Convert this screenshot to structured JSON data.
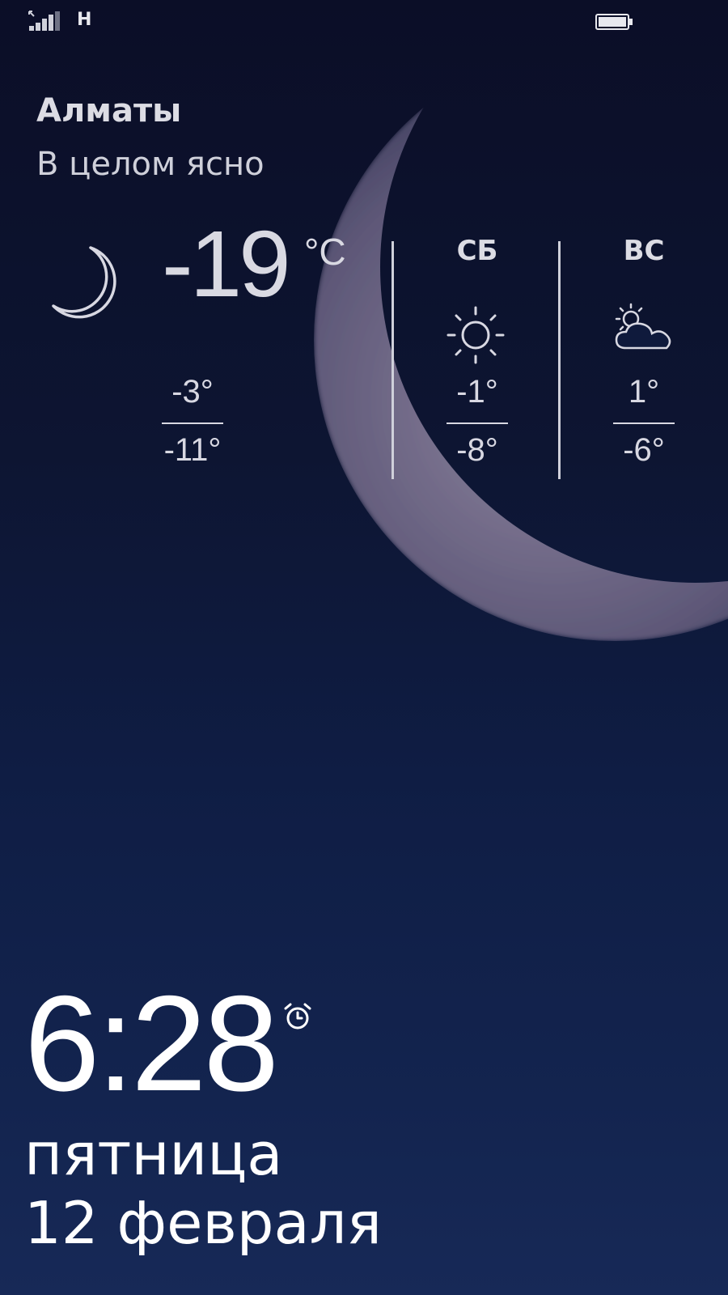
{
  "status_bar": {
    "network": "H",
    "signal_icon": "signal-bars-icon",
    "battery_icon": "battery-icon"
  },
  "weather": {
    "city": "Алматы",
    "condition": "В целом ясно",
    "current": {
      "icon": "moon-icon",
      "temp": "-19",
      "unit": "°C",
      "high": "-3°",
      "low": "-11°"
    },
    "forecast": [
      {
        "day": "СБ",
        "icon": "sun-icon",
        "high": "-1°",
        "low": "-8°"
      },
      {
        "day": "ВС",
        "icon": "partly-cloudy-icon",
        "high": "1°",
        "low": "-6°"
      }
    ]
  },
  "lock": {
    "time": "6:28",
    "alarm_icon": "alarm-clock-icon",
    "weekday": "пятница",
    "date": "12 февраля"
  },
  "colors": {
    "background_top": "#0b0e27",
    "background_bottom": "#172957",
    "text": "#ffffff",
    "muted_text": "#d8d8e2"
  }
}
